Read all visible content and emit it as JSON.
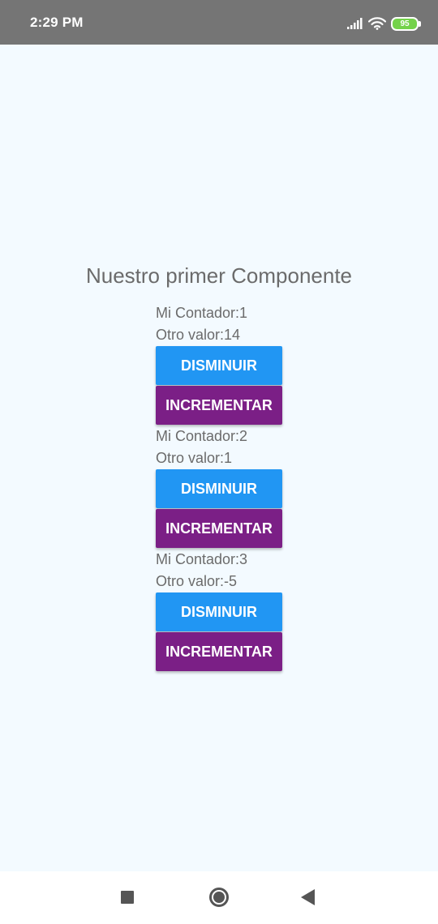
{
  "status_bar": {
    "time": "2:29 PM",
    "battery_level": "95",
    "icons": [
      "signal-icon",
      "wifi-icon",
      "battery-icon"
    ],
    "battery_color": "#74d24a"
  },
  "main": {
    "title": "Nuestro primer Componente",
    "counters": [
      {
        "contador_text": "Mi Contador:1",
        "otro_valor_text": "Otro valor:14",
        "decrease_label": "DISMINUIR",
        "increase_label": "INCREMENTAR"
      },
      {
        "contador_text": "Mi Contador:2",
        "otro_valor_text": "Otro valor:1",
        "decrease_label": "DISMINUIR",
        "increase_label": "INCREMENTAR"
      },
      {
        "contador_text": "Mi Contador:3",
        "otro_valor_text": "Otro valor:-5",
        "decrease_label": "DISMINUIR",
        "increase_label": "INCREMENTAR"
      }
    ]
  },
  "nav_bar": {
    "icons": [
      "recents-icon",
      "home-icon",
      "back-icon"
    ]
  },
  "colors": {
    "decrease_button": "#2196f3",
    "increase_button": "#7b1f86",
    "background": "#f3faff",
    "status_bar": "#757575",
    "text": "#6b6b6b"
  }
}
